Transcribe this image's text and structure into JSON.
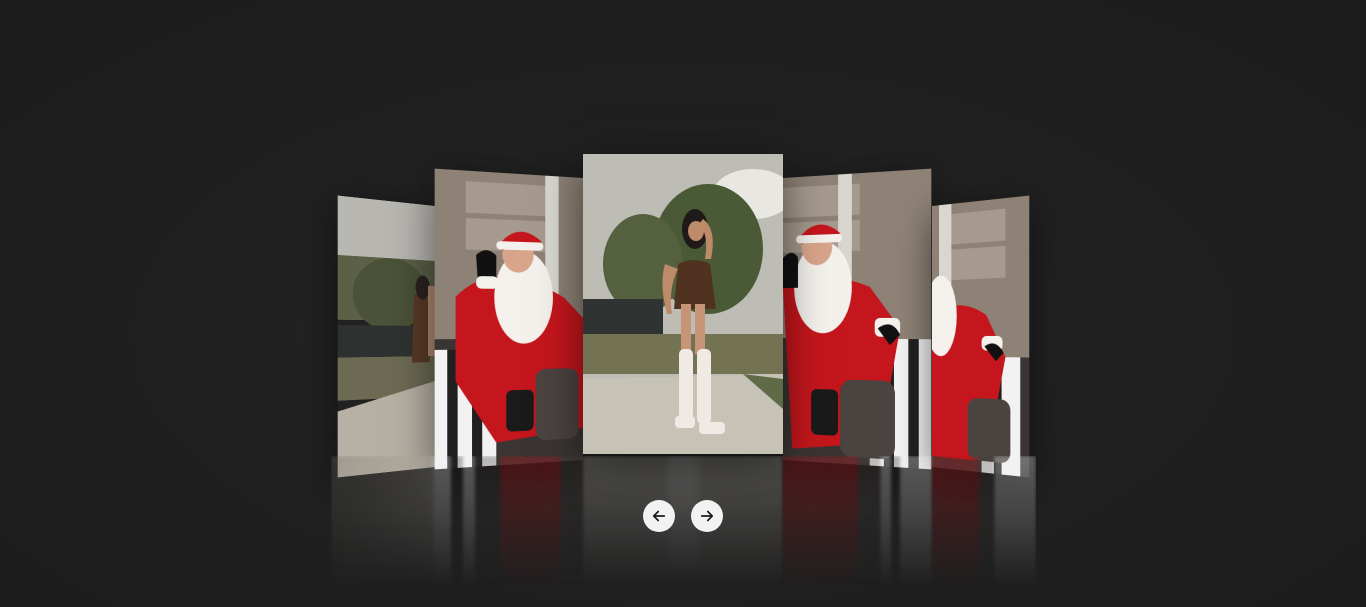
{
  "carousel": {
    "slides": [
      {
        "position": "far-left",
        "subject": "woman-in-brown-dress"
      },
      {
        "position": "left",
        "subject": "santa-claus-in-chair"
      },
      {
        "position": "center",
        "subject": "woman-in-brown-dress-white-boots"
      },
      {
        "position": "right",
        "subject": "santa-claus-in-chair"
      },
      {
        "position": "far-right",
        "subject": "santa-claus-in-chair"
      }
    ],
    "prev_icon": "arrow-left-icon",
    "next_icon": "arrow-right-icon"
  },
  "colors": {
    "background": "#1f1f1f",
    "button_bg": "#f2f2f2",
    "icon": "#1a1a1a",
    "santa_red": "#c4161c"
  }
}
